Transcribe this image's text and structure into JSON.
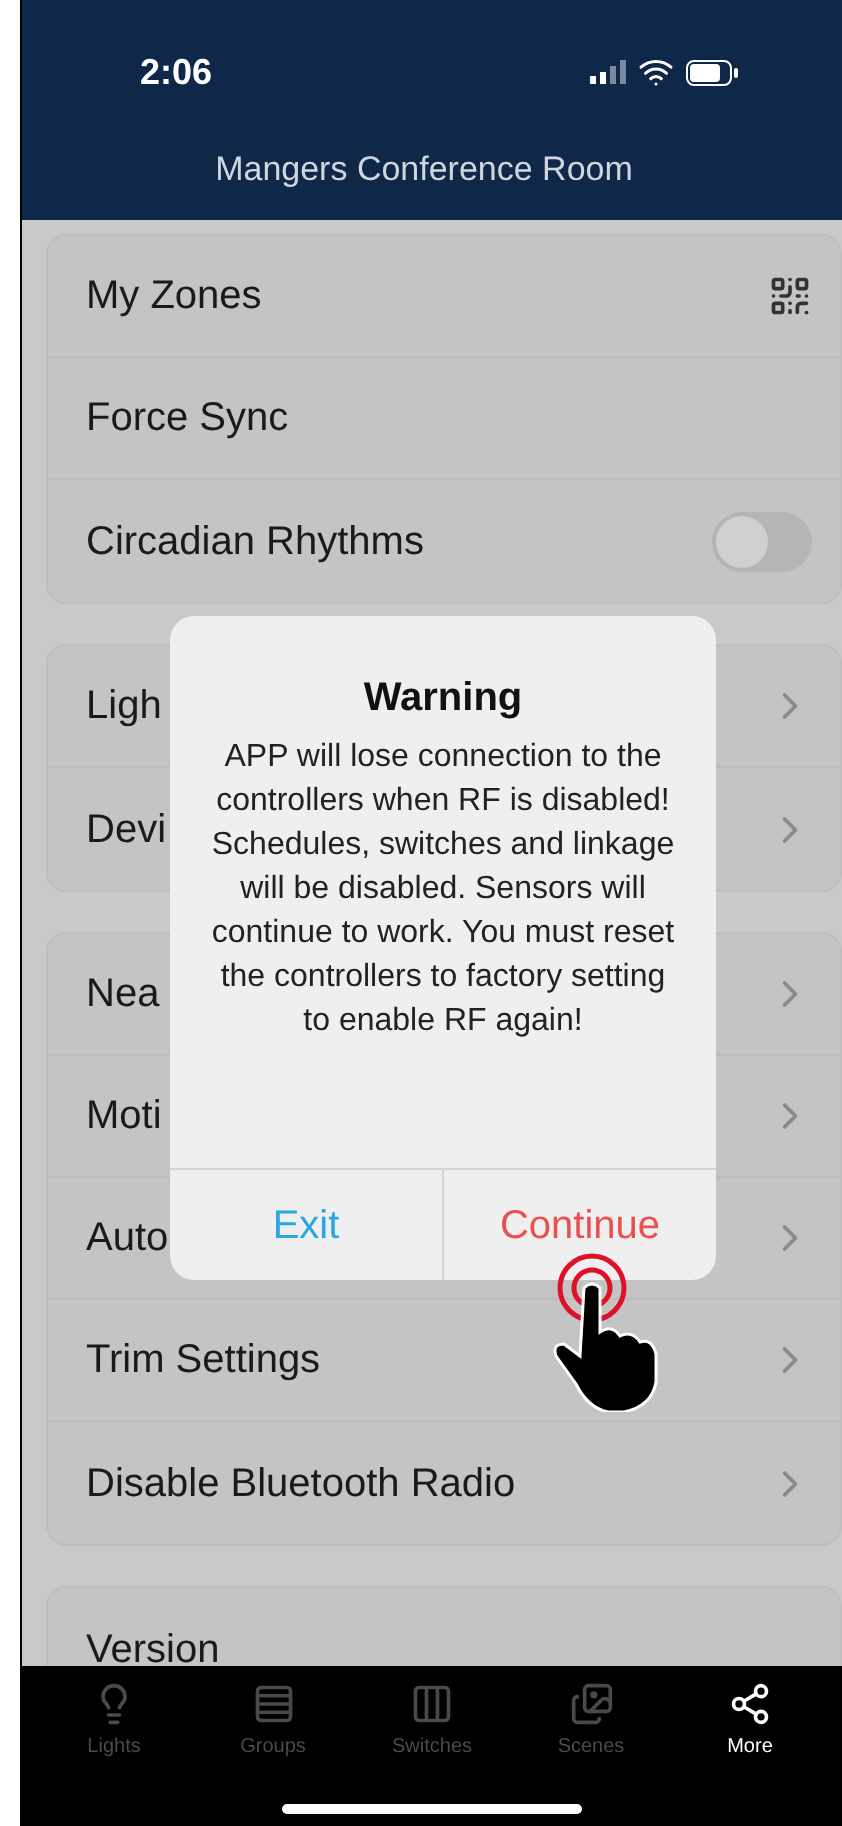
{
  "status_bar": {
    "time": "2:06"
  },
  "header": {
    "title": "Mangers Conference Room"
  },
  "groups": [
    {
      "rows": [
        {
          "label": "My Zones",
          "kind": "qr"
        },
        {
          "label": "Force Sync",
          "kind": "plain"
        },
        {
          "label": "Circadian Rhythms",
          "kind": "toggle",
          "on": false
        }
      ]
    },
    {
      "rows": [
        {
          "label": "Ligh",
          "kind": "link"
        },
        {
          "label": "Devi",
          "kind": "link"
        }
      ]
    },
    {
      "rows": [
        {
          "label": "Nea",
          "kind": "link"
        },
        {
          "label": "Moti",
          "kind": "link"
        },
        {
          "label": "Auto",
          "kind": "link"
        },
        {
          "label": "Trim Settings",
          "kind": "link"
        },
        {
          "label": "Disable Bluetooth Radio",
          "kind": "link"
        }
      ]
    },
    {
      "rows": [
        {
          "label": "Version",
          "kind": "plain"
        }
      ]
    }
  ],
  "dialog": {
    "title": "Warning",
    "message": "APP will lose connection to the controllers when RF is disabled! Schedules, switches and linkage will be disabled. Sensors will continue to work. You must reset the controllers to factory setting to enable RF again!",
    "buttons": [
      {
        "label": "Exit",
        "kind": "cancel"
      },
      {
        "label": "Continue",
        "kind": "destructive"
      }
    ]
  },
  "tab_bar": [
    {
      "label": "Lights",
      "selected": false
    },
    {
      "label": "Groups",
      "selected": false
    },
    {
      "label": "Switches",
      "selected": false
    },
    {
      "label": "Scenes",
      "selected": false
    },
    {
      "label": "More",
      "selected": true
    }
  ]
}
